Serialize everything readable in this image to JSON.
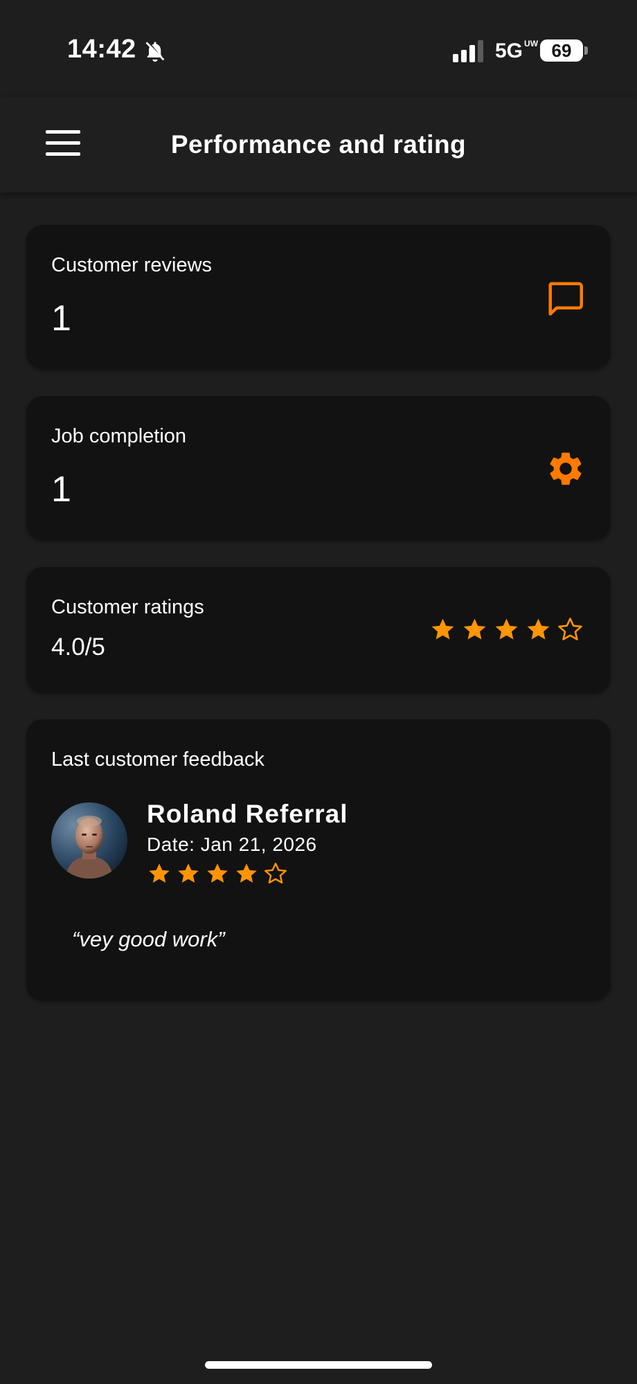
{
  "status_bar": {
    "time": "14:42",
    "network": "5G",
    "network_sup": "UW",
    "battery": "69",
    "icons": [
      "bell-slash-icon",
      "signal-bars-icon",
      "battery-icon"
    ]
  },
  "header": {
    "title": "Performance and rating",
    "menu_icon": "hamburger-menu-icon"
  },
  "cards": {
    "reviews": {
      "label": "Customer reviews",
      "value": "1",
      "icon": "chat-bubble-icon"
    },
    "job_completion": {
      "label": "Job completion",
      "value": "1",
      "icon": "gear-icon"
    },
    "ratings": {
      "label": "Customer ratings",
      "value": "4.0/5",
      "rating": 4,
      "max": 5
    },
    "feedback": {
      "label": "Last customer feedback",
      "name": "Roland Referral",
      "date": "Date: Jan 21, 2026",
      "rating": 4,
      "max": 5,
      "quote": "“vey good work”"
    }
  },
  "colors": {
    "accent": "#ff7a00",
    "star": "#ff9500",
    "card_bg": "#121212",
    "page_bg": "#1e1e1e"
  }
}
